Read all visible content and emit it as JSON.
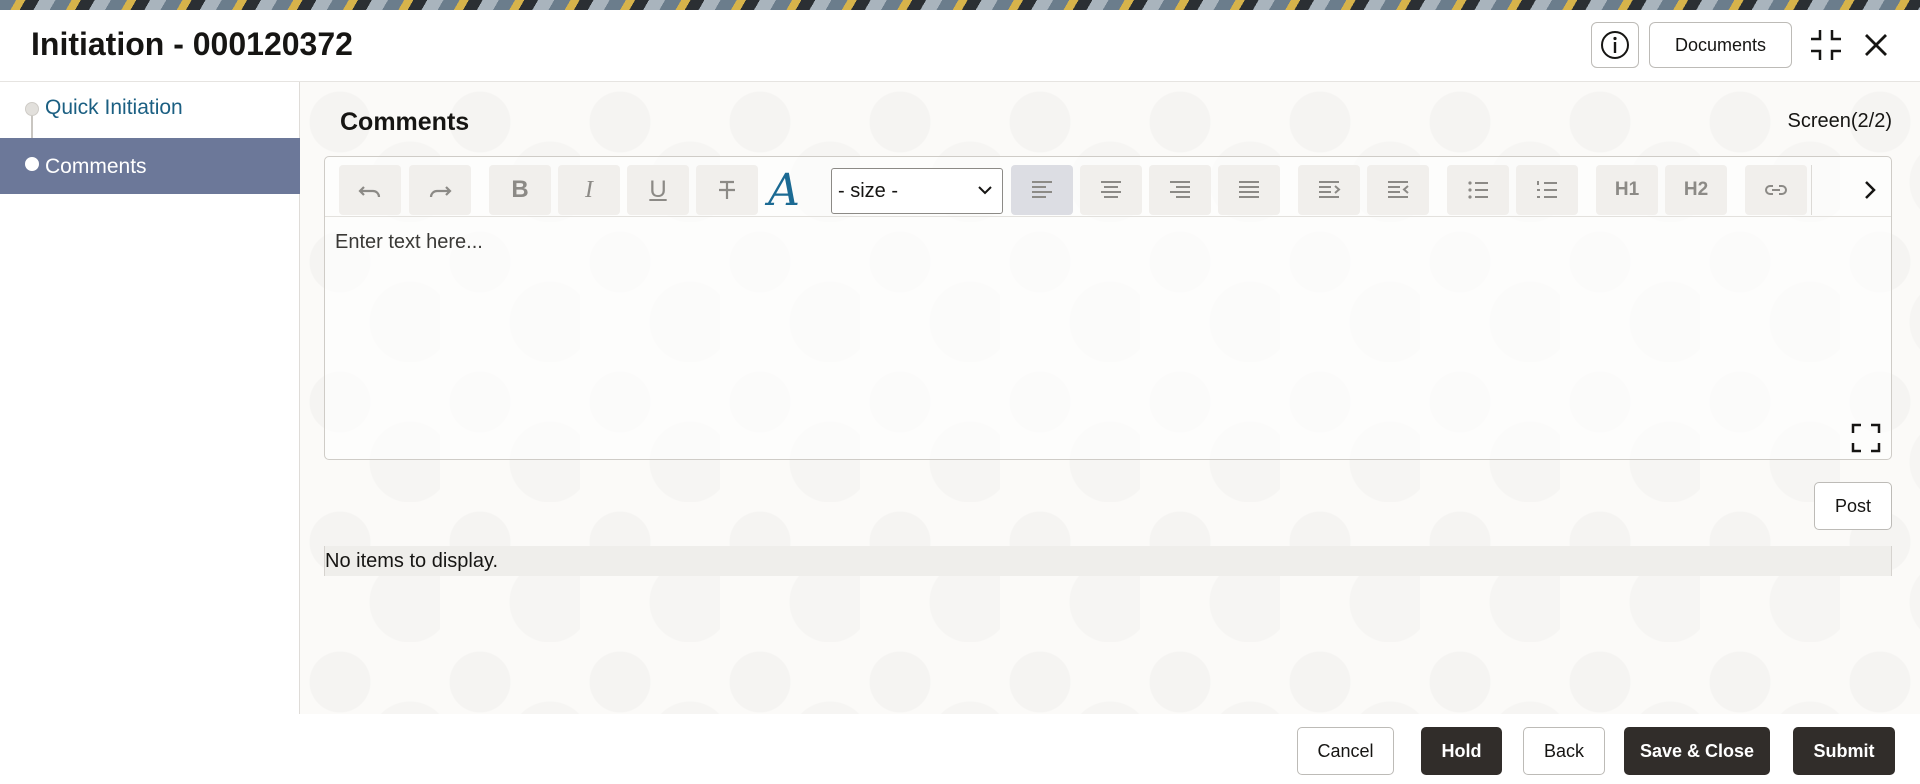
{
  "header": {
    "title": "Initiation - 000120372",
    "documents_label": "Documents"
  },
  "sidebar": {
    "items": [
      {
        "label": "Quick Initiation",
        "state": "link"
      },
      {
        "label": "Comments",
        "state": "selected"
      }
    ]
  },
  "main": {
    "section_title": "Comments",
    "screen_indicator": "Screen(2/2)",
    "editor": {
      "size_select_value": "- size -",
      "placeholder": "Enter text here...",
      "toolbar_icons": [
        "undo-icon",
        "redo-icon",
        "bold-icon",
        "italic-icon",
        "underline-icon",
        "strikethrough-icon",
        "font-color-icon",
        "size-select",
        "align-left-icon",
        "align-center-icon",
        "align-right-icon",
        "justify-icon",
        "indent-icon",
        "outdent-icon",
        "bullet-list-icon",
        "numbered-list-icon",
        "heading1-icon",
        "heading2-icon",
        "link-icon",
        "more-icon"
      ],
      "h1_label": "H1",
      "h2_label": "H2",
      "bold_label": "B",
      "italic_label": "I",
      "underline_label": "U",
      "font_color_label": "A"
    },
    "post_label": "Post",
    "empty_message": "No items to display."
  },
  "footer": {
    "cancel": "Cancel",
    "hold": "Hold",
    "back": "Back",
    "save_close": "Save & Close",
    "submit": "Submit"
  },
  "colors": {
    "selected_nav_bg": "#6c7899",
    "link_color": "#1b5f82",
    "primary_button": "#312d2a"
  }
}
